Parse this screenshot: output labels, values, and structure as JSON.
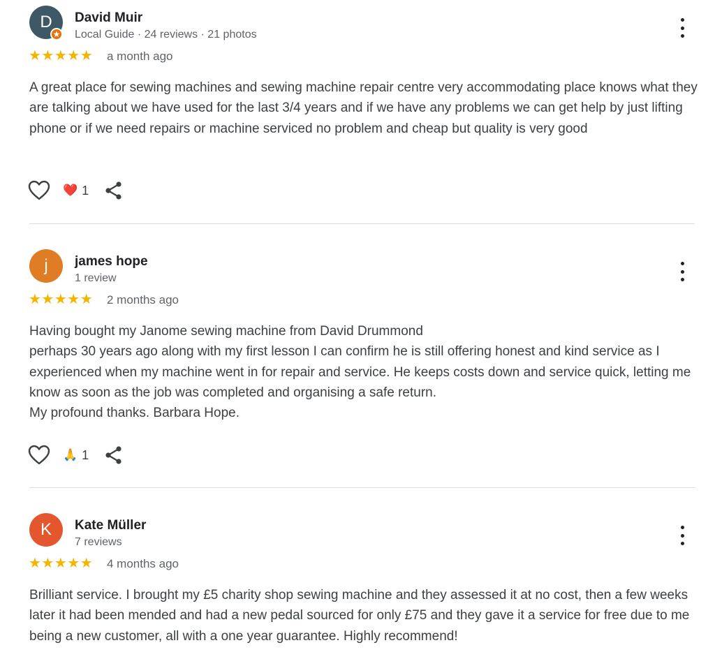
{
  "reviews": [
    {
      "name": "David Muir",
      "initial": "D",
      "avatar_color": "#3f5866",
      "local_guide": true,
      "meta": "Local Guide · 24 reviews · 21 photos",
      "stars": "★★★★★",
      "rating": 5,
      "when": "a month ago",
      "text": "A great place for sewing machines and sewing machine repair centre very accommodating place knows what they are talking about we have used for the last 3/4 years and if we have any problems we can get help by just lifting phone or if we need repairs or machine serviced no problem and cheap but quality is very good",
      "reaction_emoji": "❤️",
      "reaction_count": "1"
    },
    {
      "name": "james hope",
      "initial": "j",
      "avatar_color": "#e07c24",
      "local_guide": false,
      "meta": "1 review",
      "stars": "★★★★★",
      "rating": 5,
      "when": "2 months ago",
      "text": "Having bought my Janome sewing machine from David Drummond\nperhaps 30 years ago along with my first lesson I can confirm he is still offering honest and kind service as I experienced when my machine went in for repair and service. He keeps costs down and service quick, letting me know as soon as the job was completed and organising a safe return.\nMy profound thanks. Barbara Hope.",
      "reaction_emoji": "🙏",
      "reaction_count": "1"
    },
    {
      "name": "Kate Müller",
      "initial": "K",
      "avatar_color": "#e4572e",
      "local_guide": false,
      "meta": "7 reviews",
      "stars": "★★★★★",
      "rating": 5,
      "when": "4 months ago",
      "text": "Brilliant service. I brought my £5 charity shop sewing machine and they assessed it at no cost, then a few weeks later it had been mended and had a new pedal sourced for only £75 and they gave it a service for free due to me being a new customer, all with a one year guarantee. Highly recommend!"
    }
  ]
}
